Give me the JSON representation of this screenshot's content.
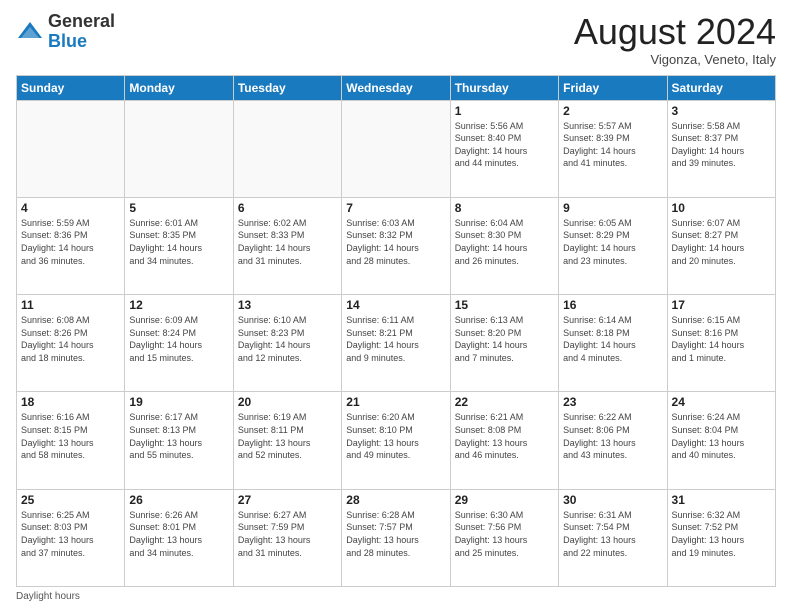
{
  "logo": {
    "general": "General",
    "blue": "Blue"
  },
  "title": "August 2024",
  "subtitle": "Vigonza, Veneto, Italy",
  "days_of_week": [
    "Sunday",
    "Monday",
    "Tuesday",
    "Wednesday",
    "Thursday",
    "Friday",
    "Saturday"
  ],
  "footer": {
    "daylight_label": "Daylight hours"
  },
  "weeks": [
    [
      {
        "day": "",
        "info": ""
      },
      {
        "day": "",
        "info": ""
      },
      {
        "day": "",
        "info": ""
      },
      {
        "day": "",
        "info": ""
      },
      {
        "day": "1",
        "info": "Sunrise: 5:56 AM\nSunset: 8:40 PM\nDaylight: 14 hours\nand 44 minutes."
      },
      {
        "day": "2",
        "info": "Sunrise: 5:57 AM\nSunset: 8:39 PM\nDaylight: 14 hours\nand 41 minutes."
      },
      {
        "day": "3",
        "info": "Sunrise: 5:58 AM\nSunset: 8:37 PM\nDaylight: 14 hours\nand 39 minutes."
      }
    ],
    [
      {
        "day": "4",
        "info": "Sunrise: 5:59 AM\nSunset: 8:36 PM\nDaylight: 14 hours\nand 36 minutes."
      },
      {
        "day": "5",
        "info": "Sunrise: 6:01 AM\nSunset: 8:35 PM\nDaylight: 14 hours\nand 34 minutes."
      },
      {
        "day": "6",
        "info": "Sunrise: 6:02 AM\nSunset: 8:33 PM\nDaylight: 14 hours\nand 31 minutes."
      },
      {
        "day": "7",
        "info": "Sunrise: 6:03 AM\nSunset: 8:32 PM\nDaylight: 14 hours\nand 28 minutes."
      },
      {
        "day": "8",
        "info": "Sunrise: 6:04 AM\nSunset: 8:30 PM\nDaylight: 14 hours\nand 26 minutes."
      },
      {
        "day": "9",
        "info": "Sunrise: 6:05 AM\nSunset: 8:29 PM\nDaylight: 14 hours\nand 23 minutes."
      },
      {
        "day": "10",
        "info": "Sunrise: 6:07 AM\nSunset: 8:27 PM\nDaylight: 14 hours\nand 20 minutes."
      }
    ],
    [
      {
        "day": "11",
        "info": "Sunrise: 6:08 AM\nSunset: 8:26 PM\nDaylight: 14 hours\nand 18 minutes."
      },
      {
        "day": "12",
        "info": "Sunrise: 6:09 AM\nSunset: 8:24 PM\nDaylight: 14 hours\nand 15 minutes."
      },
      {
        "day": "13",
        "info": "Sunrise: 6:10 AM\nSunset: 8:23 PM\nDaylight: 14 hours\nand 12 minutes."
      },
      {
        "day": "14",
        "info": "Sunrise: 6:11 AM\nSunset: 8:21 PM\nDaylight: 14 hours\nand 9 minutes."
      },
      {
        "day": "15",
        "info": "Sunrise: 6:13 AM\nSunset: 8:20 PM\nDaylight: 14 hours\nand 7 minutes."
      },
      {
        "day": "16",
        "info": "Sunrise: 6:14 AM\nSunset: 8:18 PM\nDaylight: 14 hours\nand 4 minutes."
      },
      {
        "day": "17",
        "info": "Sunrise: 6:15 AM\nSunset: 8:16 PM\nDaylight: 14 hours\nand 1 minute."
      }
    ],
    [
      {
        "day": "18",
        "info": "Sunrise: 6:16 AM\nSunset: 8:15 PM\nDaylight: 13 hours\nand 58 minutes."
      },
      {
        "day": "19",
        "info": "Sunrise: 6:17 AM\nSunset: 8:13 PM\nDaylight: 13 hours\nand 55 minutes."
      },
      {
        "day": "20",
        "info": "Sunrise: 6:19 AM\nSunset: 8:11 PM\nDaylight: 13 hours\nand 52 minutes."
      },
      {
        "day": "21",
        "info": "Sunrise: 6:20 AM\nSunset: 8:10 PM\nDaylight: 13 hours\nand 49 minutes."
      },
      {
        "day": "22",
        "info": "Sunrise: 6:21 AM\nSunset: 8:08 PM\nDaylight: 13 hours\nand 46 minutes."
      },
      {
        "day": "23",
        "info": "Sunrise: 6:22 AM\nSunset: 8:06 PM\nDaylight: 13 hours\nand 43 minutes."
      },
      {
        "day": "24",
        "info": "Sunrise: 6:24 AM\nSunset: 8:04 PM\nDaylight: 13 hours\nand 40 minutes."
      }
    ],
    [
      {
        "day": "25",
        "info": "Sunrise: 6:25 AM\nSunset: 8:03 PM\nDaylight: 13 hours\nand 37 minutes."
      },
      {
        "day": "26",
        "info": "Sunrise: 6:26 AM\nSunset: 8:01 PM\nDaylight: 13 hours\nand 34 minutes."
      },
      {
        "day": "27",
        "info": "Sunrise: 6:27 AM\nSunset: 7:59 PM\nDaylight: 13 hours\nand 31 minutes."
      },
      {
        "day": "28",
        "info": "Sunrise: 6:28 AM\nSunset: 7:57 PM\nDaylight: 13 hours\nand 28 minutes."
      },
      {
        "day": "29",
        "info": "Sunrise: 6:30 AM\nSunset: 7:56 PM\nDaylight: 13 hours\nand 25 minutes."
      },
      {
        "day": "30",
        "info": "Sunrise: 6:31 AM\nSunset: 7:54 PM\nDaylight: 13 hours\nand 22 minutes."
      },
      {
        "day": "31",
        "info": "Sunrise: 6:32 AM\nSunset: 7:52 PM\nDaylight: 13 hours\nand 19 minutes."
      }
    ]
  ]
}
